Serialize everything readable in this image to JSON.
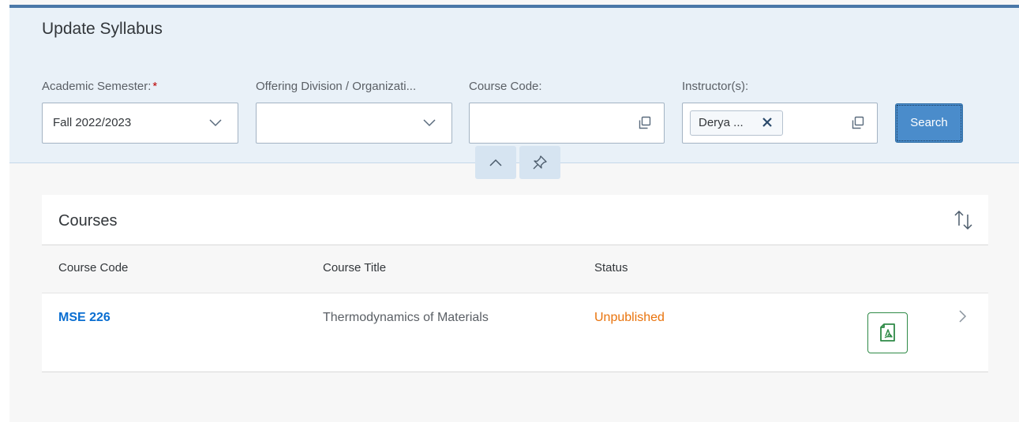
{
  "header": {
    "title": "Update Syllabus"
  },
  "filters": {
    "semester": {
      "label": "Academic Semester:",
      "required_mark": "*",
      "value": "Fall 2022/2023"
    },
    "division": {
      "label": "Offering Division / Organizati...",
      "value": ""
    },
    "course_code": {
      "label": "Course Code:",
      "value": ""
    },
    "instructors": {
      "label": "Instructor(s):",
      "token": "Derya ..."
    },
    "search_label": "Search"
  },
  "courses": {
    "title": "Courses",
    "columns": [
      "Course Code",
      "Course Title",
      "Status"
    ],
    "rows": [
      {
        "code": "MSE 226",
        "title": "Thermodynamics of Materials",
        "status": "Unpublished"
      }
    ]
  },
  "colors": {
    "accent": "#4a8ccb",
    "link": "#0a6ed1",
    "status_unpublished": "#e9730c",
    "pdf_icon": "#2f8a47",
    "header_bg": "#e9f1f8"
  },
  "icons": {
    "dropdown": "chevron-down-icon",
    "value_help": "value-help-icon",
    "token_remove": "close-icon",
    "collapse": "chevron-up-icon",
    "pin": "pin-icon",
    "sort": "sort-icon",
    "pdf": "pdf-icon",
    "row_nav": "chevron-right-icon"
  }
}
